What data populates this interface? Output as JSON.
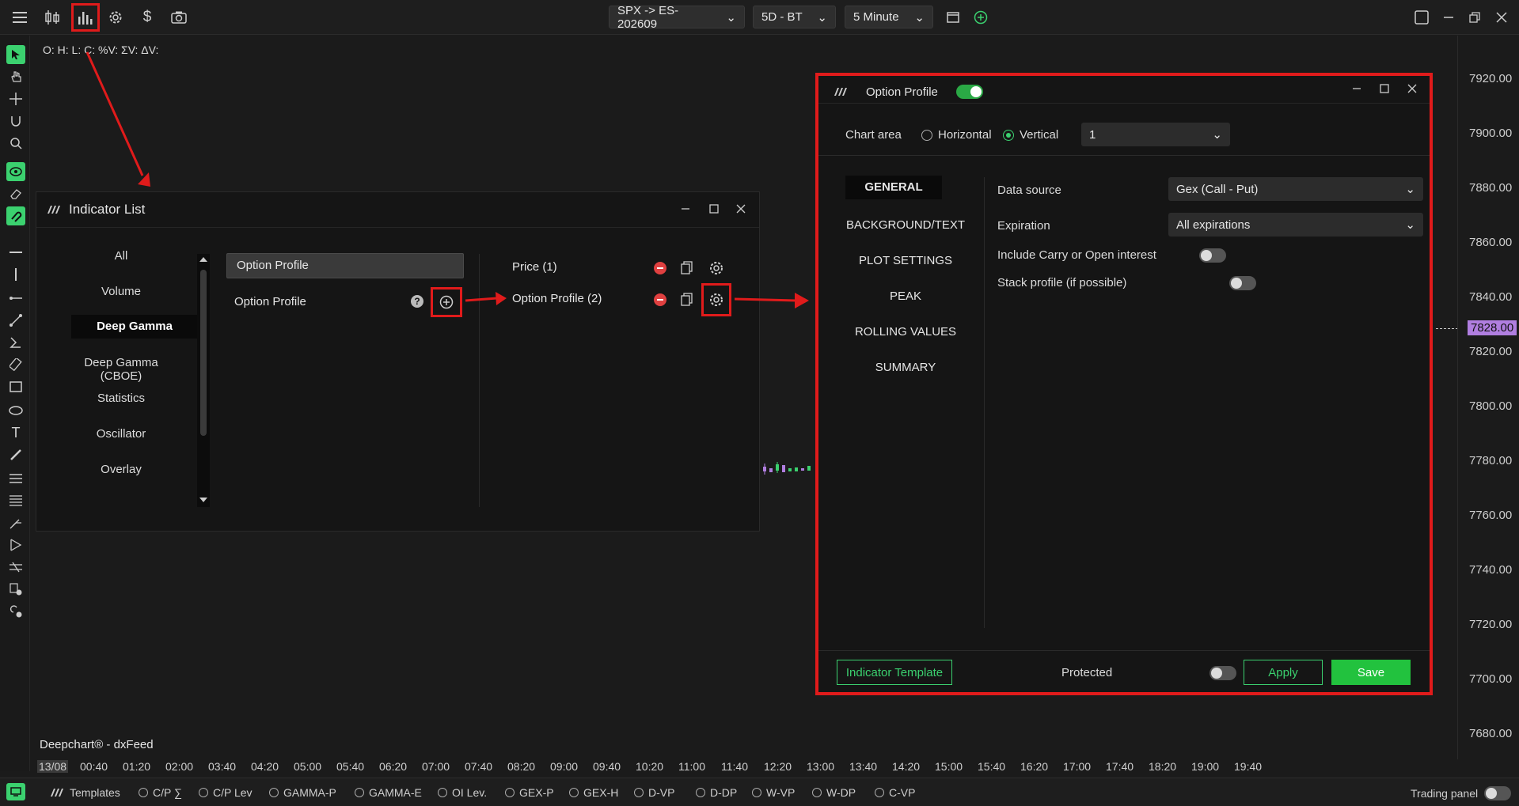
{
  "colors": {
    "accent_green": "#3bd16f",
    "highlight_red": "#e01b1b",
    "price_marker": "#b07ee0"
  },
  "toolbar": {
    "symbol": "SPX -> ES-202609",
    "range": "5D - BT",
    "interval": "5 Minute"
  },
  "chart": {
    "ohlc_label": "O: H: L: C: %V: ΣV: ΔV:",
    "watermark": "Deepchart® - dxFeed",
    "current_price": "7828.00",
    "price_ticks": [
      "7920.00",
      "7900.00",
      "7880.00",
      "7860.00",
      "7840.00",
      "7820.00",
      "7800.00",
      "7780.00",
      "7760.00",
      "7740.00",
      "7720.00",
      "7700.00",
      "7680.00"
    ],
    "time_ticks": [
      "13/08",
      "00:40",
      "01:20",
      "02:00",
      "03:40",
      "04:20",
      "05:00",
      "05:40",
      "06:20",
      "07:00",
      "07:40",
      "08:20",
      "09:00",
      "09:40",
      "10:20",
      "11:00",
      "11:40",
      "12:20",
      "13:00",
      "13:40",
      "14:20",
      "15:00",
      "15:40",
      "16:20",
      "17:00",
      "17:40",
      "18:20",
      "19:00",
      "19:40"
    ]
  },
  "indicator_list": {
    "title": "Indicator List",
    "categories": [
      "All",
      "Volume",
      "Deep Gamma",
      "Deep Gamma (CBOE)",
      "Statistics",
      "Oscillator",
      "Overlay"
    ],
    "selected_category": "Deep Gamma",
    "search_value": "Option Profile",
    "results": [
      "Option Profile"
    ],
    "active": [
      "Price (1)",
      "Option Profile (2)"
    ]
  },
  "option_profile": {
    "title": "Option Profile",
    "chart_area_label": "Chart area",
    "horizontal_label": "Horizontal",
    "vertical_label": "Vertical",
    "chart_area_value": "1",
    "menu": [
      "GENERAL",
      "BACKGROUND/TEXT",
      "PLOT SETTINGS",
      "PEAK",
      "ROLLING VALUES",
      "SUMMARY"
    ],
    "data_source_label": "Data source",
    "data_source_value": "Gex (Call - Put)",
    "expiration_label": "Expiration",
    "expiration_value": "All expirations",
    "carry_label": "Include Carry or Open interest",
    "stack_label": "Stack profile (if possible)",
    "template_button": "Indicator Template",
    "protected_label": "Protected",
    "apply_button": "Apply",
    "save_button": "Save"
  },
  "bottombar": {
    "templates_label": "Templates",
    "items": [
      "C/P ∑",
      "C/P Lev",
      "GAMMA-P",
      "GAMMA-E",
      "OI Lev.",
      "GEX-P",
      "GEX-H",
      "D-VP",
      "D-DP",
      "W-VP",
      "W-DP",
      "C-VP"
    ],
    "trading_panel_label": "Trading panel"
  }
}
